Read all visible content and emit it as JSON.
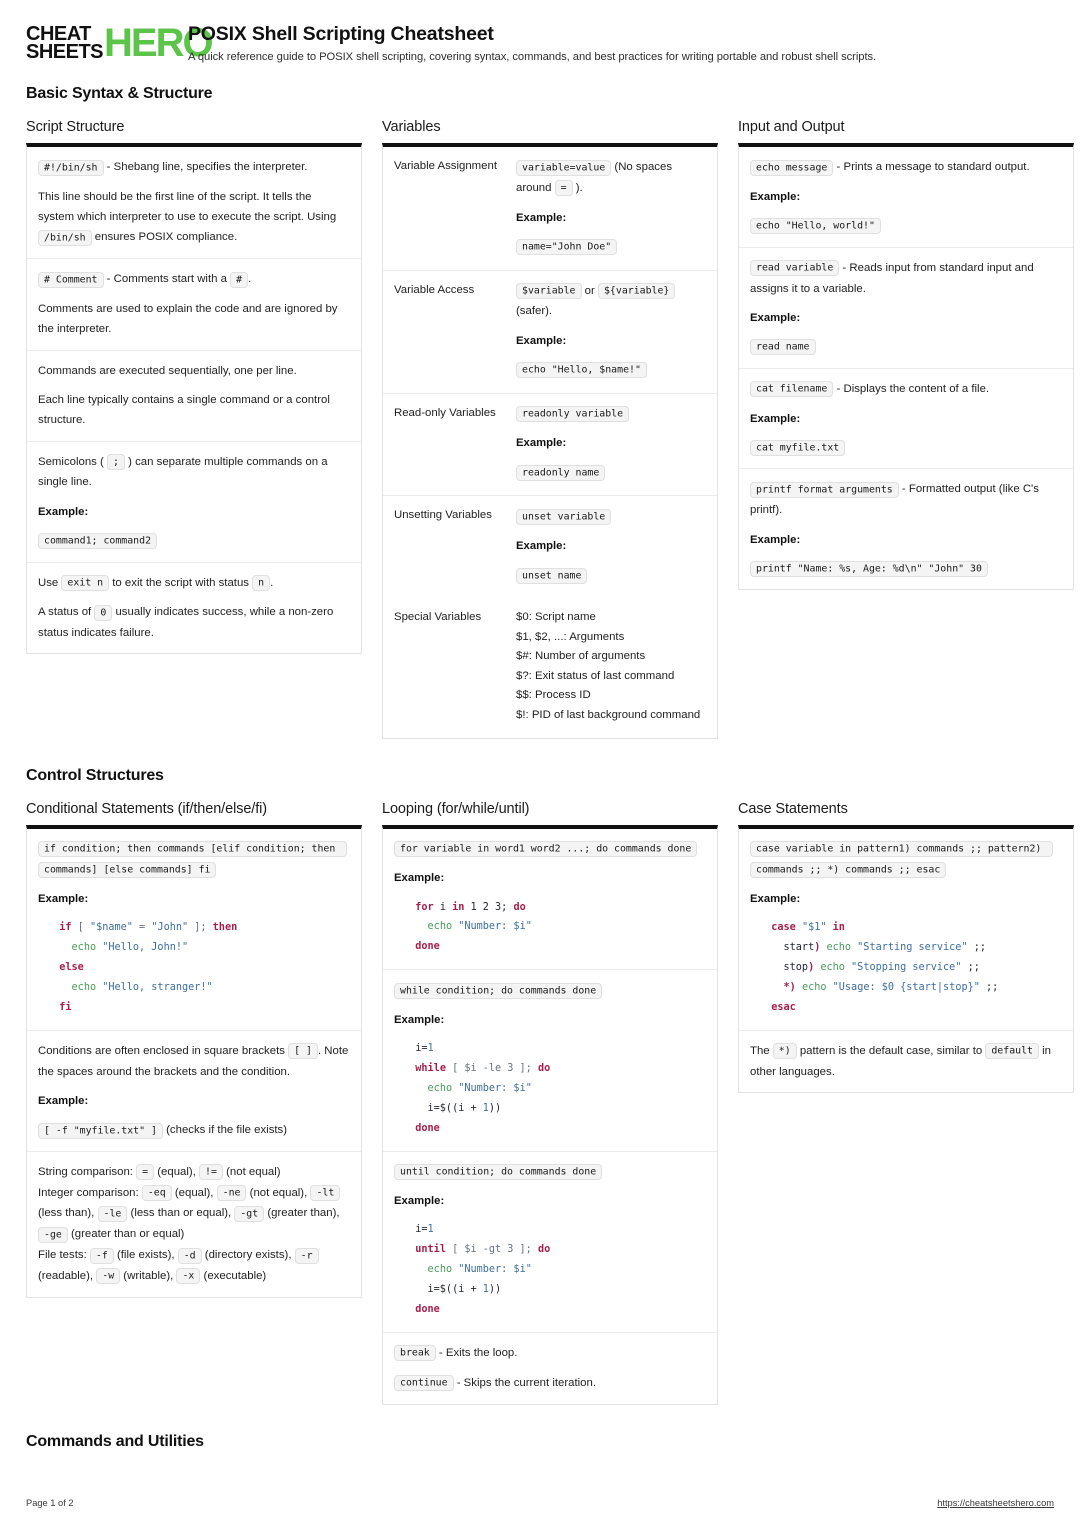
{
  "brand": {
    "word1": "CHEAT",
    "word2": "SHEETS",
    "word3": "HERO",
    "accent_color": "#5cc44a"
  },
  "header": {
    "title": "POSIX Shell Scripting Cheatsheet",
    "subtitle": "A quick reference guide to POSIX shell scripting, covering syntax, commands, and best practices for writing portable and robust shell scripts."
  },
  "sections": {
    "basic": "Basic Syntax & Structure",
    "control": "Control Structures",
    "commands": "Commands and Utilities"
  },
  "script_structure": {
    "title": "Script Structure",
    "r1_code": "#!/bin/sh",
    "r1_text": " - Shebang line, specifies the interpreter.",
    "r1_p2a": "This line should be the first line of the script. It tells the system which interpreter to use to execute the script. Using ",
    "r1_p2code": "/bin/sh",
    "r1_p2b": " ensures POSIX compliance.",
    "r2_code": "# Comment",
    "r2_text": " - Comments start with a ",
    "r2_code2": "#",
    "r2_tail": ".",
    "r2_p2": "Comments are used to explain the code and are ignored by the interpreter.",
    "r3_p1": "Commands are executed sequentially, one per line.",
    "r3_p2": "Each line typically contains a single command or a control structure.",
    "r4_a": "Semicolons ( ",
    "r4_code": ";",
    "r4_b": " ) can separate multiple commands on a single line.",
    "r4_example_label": "Example:",
    "r4_example_code": "command1; command2",
    "r5_a": "Use ",
    "r5_code": "exit n",
    "r5_b": " to exit the script with status ",
    "r5_code2": "n",
    "r5_c": ".",
    "r5_p2a": "A status of ",
    "r5_p2code": "0",
    "r5_p2b": " usually indicates success, while a non-zero status indicates failure."
  },
  "variables": {
    "title": "Variables",
    "example_label": "Example:",
    "rows": [
      {
        "term": "Variable Assignment",
        "code": "variable=value",
        "text": " (No spaces around ",
        "code2": "=",
        "tail": " ).",
        "example": "name=\"John Doe\""
      },
      {
        "term": "Variable Access",
        "code": "$variable",
        "text": " or ",
        "code2": "${variable}",
        "tail": " (safer).",
        "example": "echo \"Hello, $name!\""
      },
      {
        "term": "Read-only Variables",
        "code": "readonly variable",
        "text": "",
        "code2": "",
        "tail": "",
        "example": "readonly name"
      },
      {
        "term": "Unsetting Variables",
        "code": "unset variable",
        "text": "",
        "code2": "",
        "tail": "",
        "example": "unset name"
      }
    ],
    "special_term": "Special Variables",
    "special_list": [
      "$0: Script name",
      "$1, $2, ...: Arguments",
      "$#: Number of arguments",
      "$?: Exit status of last command",
      "$$: Process ID",
      "$!: PID of last background command"
    ]
  },
  "input_output": {
    "title": "Input and Output",
    "example_label": "Example:",
    "rows": [
      {
        "code": "echo message",
        "text": " - Prints a message to standard output.",
        "example": "echo \"Hello, world!\""
      },
      {
        "code": "read variable",
        "text": " - Reads input from standard input and assigns it to a variable.",
        "example": "read name"
      },
      {
        "code": "cat filename",
        "text": " - Displays the content of a file.",
        "example": "cat myfile.txt"
      },
      {
        "code": "printf format arguments",
        "text": " - Formatted output (like C's printf).",
        "example": "printf \"Name: %s, Age: %d\\n\" \"John\" 30"
      }
    ]
  },
  "conditionals": {
    "title": "Conditional Statements (if/then/else/fi)",
    "syntax": "if condition; then commands [elif condition; then commands] [else commands] fi",
    "example_label": "Example:",
    "example_code": [
      [
        {
          "t": "  ",
          "c": "var"
        },
        {
          "t": "if",
          "c": "kw"
        },
        {
          "t": " [ ",
          "c": "op"
        },
        {
          "t": "\"$name\"",
          "c": "str"
        },
        {
          "t": " = ",
          "c": "op"
        },
        {
          "t": "\"John\"",
          "c": "str"
        },
        {
          "t": " ]; ",
          "c": "op"
        },
        {
          "t": "then",
          "c": "kw"
        }
      ],
      [
        {
          "t": "    ",
          "c": "var"
        },
        {
          "t": "echo",
          "c": "cmd"
        },
        {
          "t": " ",
          "c": "var"
        },
        {
          "t": "\"Hello, John!\"",
          "c": "str"
        }
      ],
      [
        {
          "t": "  ",
          "c": "var"
        },
        {
          "t": "else",
          "c": "kw"
        }
      ],
      [
        {
          "t": "    ",
          "c": "var"
        },
        {
          "t": "echo",
          "c": "cmd"
        },
        {
          "t": " ",
          "c": "var"
        },
        {
          "t": "\"Hello, stranger!\"",
          "c": "str"
        }
      ],
      [
        {
          "t": "  ",
          "c": "var"
        },
        {
          "t": "fi",
          "c": "kw"
        }
      ]
    ],
    "brackets_a": "Conditions are often enclosed in square brackets ",
    "brackets_code": "[ ]",
    "brackets_b": ". Note the spaces around the brackets and the condition.",
    "brackets_example_label": "Example:",
    "brackets_example_code": "[ -f \"myfile.txt\" ]",
    "brackets_example_tail": " (checks if the file exists)",
    "comparison_lines": [
      {
        "prefix": "String comparison: ",
        "parts": [
          {
            "code": "=",
            "text": " (equal), "
          },
          {
            "code": "!=",
            "text": " (not equal)"
          }
        ]
      },
      {
        "prefix": "Integer comparison: ",
        "parts": [
          {
            "code": "-eq",
            "text": " (equal), "
          },
          {
            "code": "-ne",
            "text": " (not equal), "
          },
          {
            "code": "-lt",
            "text": " (less than), "
          },
          {
            "code": "-le",
            "text": " (less than or equal), "
          },
          {
            "code": "-gt",
            "text": " (greater than), "
          },
          {
            "code": "-ge",
            "text": " (greater than or equal)"
          }
        ]
      },
      {
        "prefix": "File tests: ",
        "parts": [
          {
            "code": "-f",
            "text": " (file exists), "
          },
          {
            "code": "-d",
            "text": " (directory exists), "
          },
          {
            "code": "-r",
            "text": " (readable), "
          },
          {
            "code": "-w",
            "text": " (writable), "
          },
          {
            "code": "-x",
            "text": " (executable)"
          }
        ]
      }
    ]
  },
  "looping": {
    "title": "Looping (for/while/until)",
    "example_label": "Example:",
    "for_syntax": "for variable in word1 word2 ...; do commands done",
    "for_code": [
      [
        {
          "t": "  ",
          "c": "var"
        },
        {
          "t": "for",
          "c": "kw"
        },
        {
          "t": " i ",
          "c": "var"
        },
        {
          "t": "in",
          "c": "kw"
        },
        {
          "t": " 1 2 3; ",
          "c": "var"
        },
        {
          "t": "do",
          "c": "kw"
        }
      ],
      [
        {
          "t": "    ",
          "c": "var"
        },
        {
          "t": "echo",
          "c": "cmd"
        },
        {
          "t": " ",
          "c": "var"
        },
        {
          "t": "\"Number: $i\"",
          "c": "str"
        }
      ],
      [
        {
          "t": "  ",
          "c": "var"
        },
        {
          "t": "done",
          "c": "kw"
        }
      ]
    ],
    "while_syntax": "while condition; do commands done",
    "while_code": [
      [
        {
          "t": "  i=",
          "c": "var"
        },
        {
          "t": "1",
          "c": "num"
        }
      ],
      [
        {
          "t": "  ",
          "c": "var"
        },
        {
          "t": "while",
          "c": "kw"
        },
        {
          "t": " [ $i -le 3 ]; ",
          "c": "op"
        },
        {
          "t": "do",
          "c": "kw"
        }
      ],
      [
        {
          "t": "    ",
          "c": "var"
        },
        {
          "t": "echo",
          "c": "cmd"
        },
        {
          "t": " ",
          "c": "var"
        },
        {
          "t": "\"Number: $i\"",
          "c": "str"
        }
      ],
      [
        {
          "t": "    i=$((i + ",
          "c": "var"
        },
        {
          "t": "1",
          "c": "num"
        },
        {
          "t": "))",
          "c": "var"
        }
      ],
      [
        {
          "t": "  ",
          "c": "var"
        },
        {
          "t": "done",
          "c": "kw"
        }
      ]
    ],
    "until_syntax": "until condition; do commands done",
    "until_code": [
      [
        {
          "t": "  i=",
          "c": "var"
        },
        {
          "t": "1",
          "c": "num"
        }
      ],
      [
        {
          "t": "  ",
          "c": "var"
        },
        {
          "t": "until",
          "c": "kw"
        },
        {
          "t": " [ $i -gt 3 ]; ",
          "c": "op"
        },
        {
          "t": "do",
          "c": "kw"
        }
      ],
      [
        {
          "t": "    ",
          "c": "var"
        },
        {
          "t": "echo",
          "c": "cmd"
        },
        {
          "t": " ",
          "c": "var"
        },
        {
          "t": "\"Number: $i\"",
          "c": "str"
        }
      ],
      [
        {
          "t": "    i=$((i + ",
          "c": "var"
        },
        {
          "t": "1",
          "c": "num"
        },
        {
          "t": "))",
          "c": "var"
        }
      ],
      [
        {
          "t": "  ",
          "c": "var"
        },
        {
          "t": "done",
          "c": "kw"
        }
      ]
    ],
    "break_code": "break",
    "break_text": " - Exits the loop.",
    "continue_code": "continue",
    "continue_text": " - Skips the current iteration."
  },
  "case_statements": {
    "title": "Case Statements",
    "syntax": "case variable in pattern1) commands ;; pattern2) commands ;; *) commands ;; esac",
    "example_label": "Example:",
    "example_code": [
      [
        {
          "t": "  ",
          "c": "var"
        },
        {
          "t": "case",
          "c": "kw"
        },
        {
          "t": " ",
          "c": "var"
        },
        {
          "t": "\"$1\"",
          "c": "str"
        },
        {
          "t": " ",
          "c": "var"
        },
        {
          "t": "in",
          "c": "kw"
        }
      ],
      [
        {
          "t": "    start",
          "c": "var"
        },
        {
          "t": ")",
          "c": "kw"
        },
        {
          "t": " ",
          "c": "var"
        },
        {
          "t": "echo",
          "c": "cmd"
        },
        {
          "t": " ",
          "c": "var"
        },
        {
          "t": "\"Starting service\"",
          "c": "str"
        },
        {
          "t": " ;;",
          "c": "var"
        }
      ],
      [
        {
          "t": "    stop",
          "c": "var"
        },
        {
          "t": ")",
          "c": "kw"
        },
        {
          "t": " ",
          "c": "var"
        },
        {
          "t": "echo",
          "c": "cmd"
        },
        {
          "t": " ",
          "c": "var"
        },
        {
          "t": "\"Stopping service\"",
          "c": "str"
        },
        {
          "t": " ;;",
          "c": "var"
        }
      ],
      [
        {
          "t": "    ",
          "c": "var"
        },
        {
          "t": "*)",
          "c": "kw"
        },
        {
          "t": " ",
          "c": "var"
        },
        {
          "t": "echo",
          "c": "cmd"
        },
        {
          "t": " ",
          "c": "var"
        },
        {
          "t": "\"Usage: $0 {start|stop}\"",
          "c": "str"
        },
        {
          "t": " ;;",
          "c": "var"
        }
      ],
      [
        {
          "t": "  ",
          "c": "var"
        },
        {
          "t": "esac",
          "c": "kw"
        }
      ]
    ],
    "note_a": "The ",
    "note_code": "*)",
    "note_b": " pattern is the default case, similar to ",
    "note_code2": "default",
    "note_c": " in other languages."
  },
  "footer": {
    "page": "Page 1 of 2",
    "url": "https://cheatsheetshero.com"
  }
}
